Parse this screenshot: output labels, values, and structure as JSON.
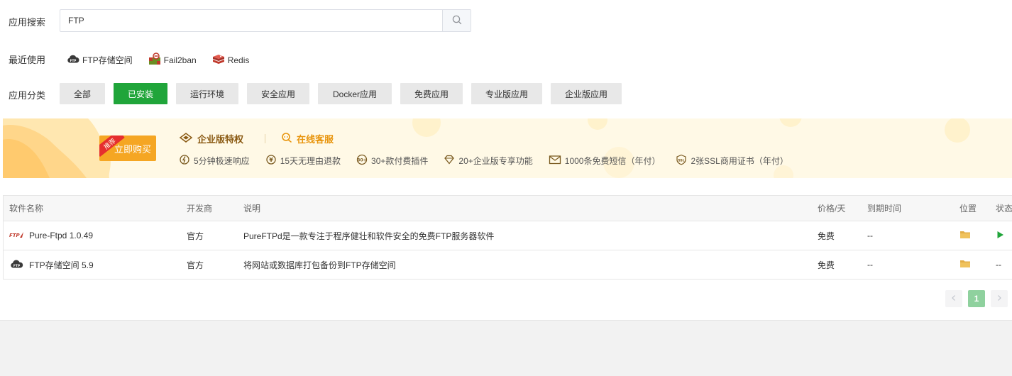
{
  "search": {
    "label": "应用搜索",
    "value": "FTP",
    "icon": "search-icon"
  },
  "recent": {
    "label": "最近使用",
    "items": [
      {
        "label": "FTP存储空间",
        "icon": "ftp-cloud-icon"
      },
      {
        "label": "Fail2ban",
        "icon": "fail2ban-icon"
      },
      {
        "label": "Redis",
        "icon": "redis-icon"
      }
    ]
  },
  "categories": {
    "label": "应用分类",
    "items": [
      "全部",
      "已安装",
      "运行环境",
      "安全应用",
      "Docker应用",
      "免费应用",
      "专业版应用",
      "企业版应用"
    ],
    "active": "已安装"
  },
  "banner": {
    "ribbon": "推荐",
    "buy_label": "立即购买",
    "title": "企业版特权",
    "service": "在线客服",
    "features": [
      {
        "label": "5分钟极速响应",
        "icon": "fast-response-icon"
      },
      {
        "label": "15天无理由退款",
        "icon": "refund-icon"
      },
      {
        "label": "30+款付费插件",
        "icon": "plugins-icon"
      },
      {
        "label": "20+企业版专享功能",
        "icon": "diamond-icon"
      },
      {
        "label": "1000条免费短信（年付）",
        "icon": "mail-icon"
      },
      {
        "label": "2张SSL商用证书（年付）",
        "icon": "ssl-icon"
      }
    ]
  },
  "table": {
    "headers": {
      "name": "软件名称",
      "developer": "开发商",
      "description": "说明",
      "price": "价格/天",
      "expire": "到期时间",
      "location": "位置",
      "status": "状态"
    },
    "rows": [
      {
        "name": "Pure-Ftpd 1.0.49",
        "icon": "pure-ftpd-icon",
        "developer": "官方",
        "description": "PureFTPd是一款专注于程序健壮和软件安全的免费FTP服务器软件",
        "price": "免费",
        "expire": "--",
        "status": "running"
      },
      {
        "name": "FTP存储空间 5.9",
        "icon": "ftp-cloud-icon",
        "developer": "官方",
        "description": "将网站或数据库打包备份到FTP存储空间",
        "price": "免费",
        "expire": "--",
        "status": "--"
      }
    ]
  },
  "pagination": {
    "current": "1"
  },
  "colors": {
    "accent": "#20a53a",
    "banner_bg": "#fff9e6",
    "buy_button": "#f5a623",
    "folder": "#f0c25c"
  }
}
